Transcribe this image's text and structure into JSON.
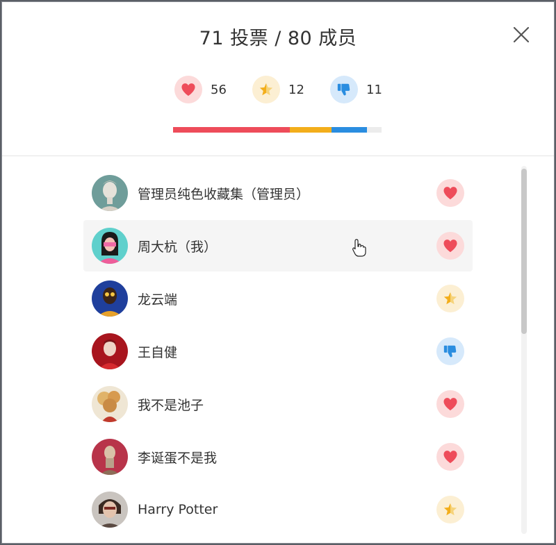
{
  "title": "71 投票 / 80 成员",
  "stats": [
    {
      "icon": "heart-icon",
      "count": "56",
      "color": "#ee4c5a"
    },
    {
      "icon": "half-star-icon",
      "count": "12",
      "color": "#f3ae1b"
    },
    {
      "icon": "thumbs-down-icon",
      "count": "11",
      "color": "#2a8de0"
    }
  ],
  "progress": {
    "love_fraction": 0.56,
    "star_fraction": 0.2,
    "down_fraction": 0.17,
    "colors": {
      "love": "#ee4c5a",
      "star": "#f3ae1b",
      "down": "#2a8de0",
      "track": "#ececec"
    }
  },
  "members": [
    {
      "name": "管理员纯色收藏集（管理员）",
      "vote": "heart-icon"
    },
    {
      "name": "周大杭（我）",
      "vote": "heart-icon"
    },
    {
      "name": "龙云端",
      "vote": "half-star-icon"
    },
    {
      "name": "王自健",
      "vote": "thumbs-down-icon"
    },
    {
      "name": "我不是池子",
      "vote": "heart-icon"
    },
    {
      "name": "李诞蛋不是我",
      "vote": "heart-icon"
    },
    {
      "name": "Harry Potter",
      "vote": "half-star-icon"
    }
  ]
}
